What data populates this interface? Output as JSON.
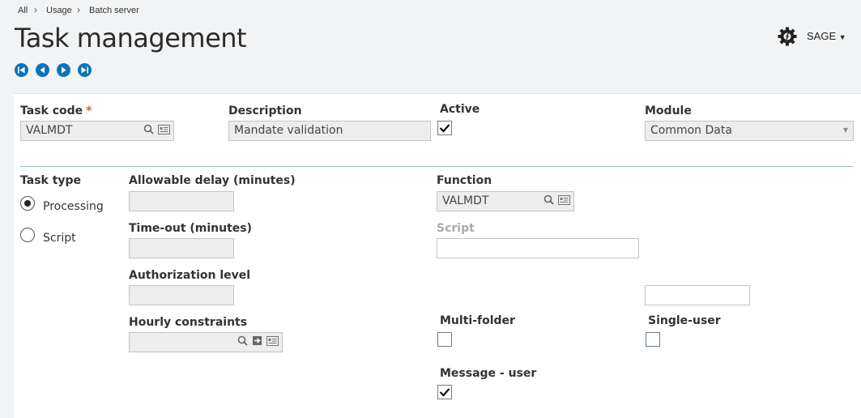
{
  "breadcrumb": [
    "All",
    "Usage",
    "Batch server"
  ],
  "title": "Task management",
  "user_menu": "SAGE",
  "fields": {
    "task_code": {
      "label": "Task code",
      "value": "VALMDT"
    },
    "description": {
      "label": "Description",
      "value": "Mandate validation"
    },
    "active": {
      "label": "Active",
      "checked": true
    },
    "module": {
      "label": "Module",
      "value": "Common Data"
    },
    "task_type": {
      "label": "Task type",
      "options": [
        "Processing",
        "Script"
      ],
      "selected": "Processing"
    },
    "allowable_delay": {
      "label": "Allowable delay (minutes)",
      "value": ""
    },
    "timeout": {
      "label": "Time-out (minutes)",
      "value": ""
    },
    "authorization_level": {
      "label": "Authorization level",
      "value": ""
    },
    "hourly_constraints": {
      "label": "Hourly constraints",
      "value": ""
    },
    "function": {
      "label": "Function",
      "value": "VALMDT"
    },
    "script": {
      "label": "Script",
      "value": ""
    },
    "extra": {
      "value": ""
    },
    "multi_folder": {
      "label": "Multi-folder",
      "checked": false
    },
    "single_user": {
      "label": "Single-user",
      "checked": false
    },
    "message_user": {
      "label": "Message - user",
      "checked": true
    }
  },
  "colors": {
    "accent": "#0b73b8",
    "required": "#e85a1b"
  }
}
